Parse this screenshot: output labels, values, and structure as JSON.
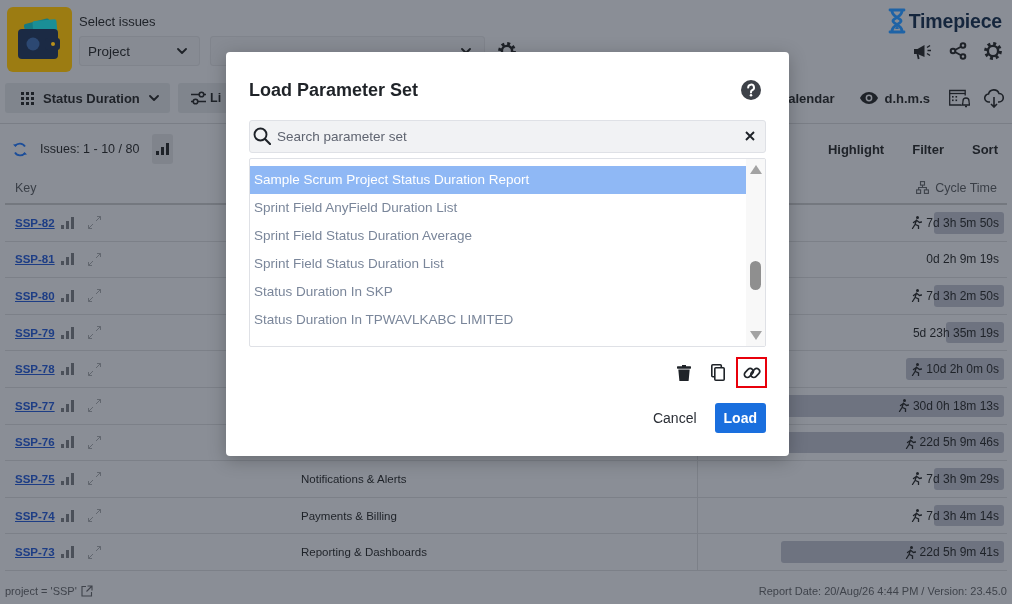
{
  "header": {
    "select_label": "Select issues",
    "source_dropdown": "Project",
    "brand": "Timepiece"
  },
  "toolbar": {
    "view_selector": "Status Duration",
    "settings_button": "Li",
    "calendar_button": "alendar",
    "format_button": "d.h.m.s"
  },
  "issue_bar": {
    "count": "Issues: 1 - 10 / 80",
    "actions": [
      "Highlight",
      "Filter",
      "Sort"
    ]
  },
  "table": {
    "columns": {
      "key": "Key",
      "cycle_time": "Cycle Time"
    },
    "rows": [
      {
        "key": "SSP-82",
        "cycle_time": "7d 3h 5m 50s",
        "level": 0.23,
        "running": true
      },
      {
        "key": "SSP-81",
        "cycle_time": "0d 2h 9m 19s",
        "running": false
      },
      {
        "key": "SSP-80",
        "cycle_time": "7d 3h 2m 50s",
        "level": 0.23,
        "running": true
      },
      {
        "key": "SSP-79",
        "cycle_time": "5d 23h 35m 19s",
        "level": 0.19,
        "running": false
      },
      {
        "key": "SSP-78",
        "cycle_time": "10d 2h 0m 0s",
        "level": 0.32,
        "running": true
      },
      {
        "key": "SSP-77",
        "cycle_time": "30d 0h 18m 13s",
        "level": 1,
        "running": true
      },
      {
        "key": "SSP-76",
        "cycle_time": "22d 5h 9m 46s",
        "level": 0.74,
        "running": true
      },
      {
        "key": "SSP-75",
        "summary": "Notifications & Alerts",
        "cycle_time": "7d 3h 9m 29s",
        "level": 0.23,
        "running": true
      },
      {
        "key": "SSP-74",
        "summary": "Payments & Billing",
        "cycle_time": "7d 3h 4m 14s",
        "level": 0.23,
        "running": true
      },
      {
        "key": "SSP-73",
        "summary": "Reporting & Dashboards",
        "cycle_time": "22d 5h 9m 41s",
        "level": 0.73,
        "running": true
      }
    ]
  },
  "status_bar": {
    "query": "project = 'SSP'",
    "report": "Report Date: 20/Aug/26 4:44 PM / Version: 23.45.0"
  },
  "dialog": {
    "title": "Load Parameter Set",
    "search": {
      "placeholder": "Search parameter set"
    },
    "items": [
      {
        "label": "Sample Scrum Project Status Duration Report",
        "selected": true
      },
      {
        "label": "Sprint Field AnyField Duration List",
        "selected": false
      },
      {
        "label": "Sprint Field Status Duration Average",
        "selected": false
      },
      {
        "label": "Sprint Field Status Duration List",
        "selected": false
      },
      {
        "label": "Status Duration In SKP",
        "selected": false
      },
      {
        "label": "Status Duration In TPWAVLKABC LIMITED",
        "selected": false
      }
    ],
    "link_button": {
      "highlighted": true
    },
    "buttons": [
      {
        "label": "Cancel",
        "kind": "secondary"
      },
      {
        "label": "Load",
        "kind": "primary"
      }
    ]
  }
}
